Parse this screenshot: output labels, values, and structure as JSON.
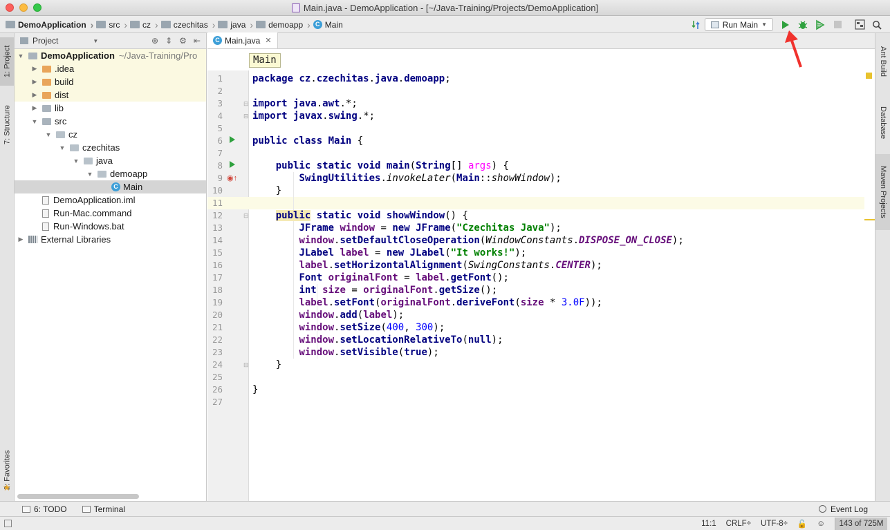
{
  "window": {
    "title": "Main.java - DemoApplication - [~/Java-Training/Projects/DemoApplication]"
  },
  "breadcrumb": [
    "DemoApplication",
    "src",
    "cz",
    "czechitas",
    "java",
    "demoapp",
    "Main"
  ],
  "toolbar": {
    "run_config": "Run Main"
  },
  "left_tabs": {
    "project": "1: Project",
    "structure": "7: Structure",
    "favorites": "2: Favorites"
  },
  "right_tabs": {
    "ant": "Ant Build",
    "database": "Database",
    "maven": "Maven Projects"
  },
  "project_panel": {
    "header": "Project",
    "tree": [
      {
        "label": "DemoApplication",
        "extra": "~/Java-Training/Pro",
        "depth": 0,
        "expanded": true,
        "icon": "module",
        "bold": true
      },
      {
        "label": ".idea",
        "depth": 1,
        "expanded": false,
        "icon": "folder-orange"
      },
      {
        "label": "build",
        "depth": 1,
        "expanded": false,
        "icon": "folder-orange"
      },
      {
        "label": "dist",
        "depth": 1,
        "expanded": false,
        "icon": "folder-orange"
      },
      {
        "label": "lib",
        "depth": 1,
        "expanded": false,
        "icon": "folder-gray"
      },
      {
        "label": "src",
        "depth": 1,
        "expanded": true,
        "icon": "folder-gray"
      },
      {
        "label": "cz",
        "depth": 2,
        "expanded": true,
        "icon": "package"
      },
      {
        "label": "czechitas",
        "depth": 3,
        "expanded": true,
        "icon": "package"
      },
      {
        "label": "java",
        "depth": 4,
        "expanded": true,
        "icon": "package"
      },
      {
        "label": "demoapp",
        "depth": 5,
        "expanded": true,
        "icon": "package"
      },
      {
        "label": "Main",
        "depth": 6,
        "icon": "class",
        "selected": true
      },
      {
        "label": "DemoApplication.iml",
        "depth": 1,
        "icon": "file"
      },
      {
        "label": "Run-Mac.command",
        "depth": 1,
        "icon": "file"
      },
      {
        "label": "Run-Windows.bat",
        "depth": 1,
        "icon": "file"
      },
      {
        "label": "External Libraries",
        "depth": 0,
        "expanded": false,
        "icon": "library"
      }
    ]
  },
  "editor": {
    "tab": "Main.java",
    "crumb": "Main",
    "current_line": 11,
    "lines": [
      "package cz.czechitas.java.demoapp;",
      "",
      "import java.awt.*;",
      "import javax.swing.*;",
      "",
      "public class Main {",
      "",
      "    public static void main(String[] args) {",
      "        SwingUtilities.invokeLater(Main::showWindow);",
      "    }",
      "",
      "    public static void showWindow() {",
      "        JFrame window = new JFrame(\"Czechitas Java\");",
      "        window.setDefaultCloseOperation(WindowConstants.DISPOSE_ON_CLOSE);",
      "        JLabel label = new JLabel(\"It works!\");",
      "        label.setHorizontalAlignment(SwingConstants.CENTER);",
      "        Font originalFont = label.getFont();",
      "        int size = originalFont.getSize();",
      "        label.setFont(originalFont.deriveFont(size * 3.0F));",
      "        window.add(label);",
      "        window.setSize(400, 300);",
      "        window.setLocationRelativeTo(null);",
      "        window.setVisible(true);",
      "    }",
      "",
      "}",
      ""
    ]
  },
  "bottom_tools": {
    "todo": "6: TODO",
    "terminal": "Terminal",
    "event_log": "Event Log"
  },
  "status": {
    "position": "11:1",
    "line_sep": "CRLF÷",
    "encoding": "UTF-8÷",
    "memory": "143 of 725M"
  },
  "colors": {
    "run_green": "#2fa13e",
    "annotation_red": "#f0322d",
    "selection": "#d5d5d5",
    "highlight_row": "#fbf9e1"
  }
}
